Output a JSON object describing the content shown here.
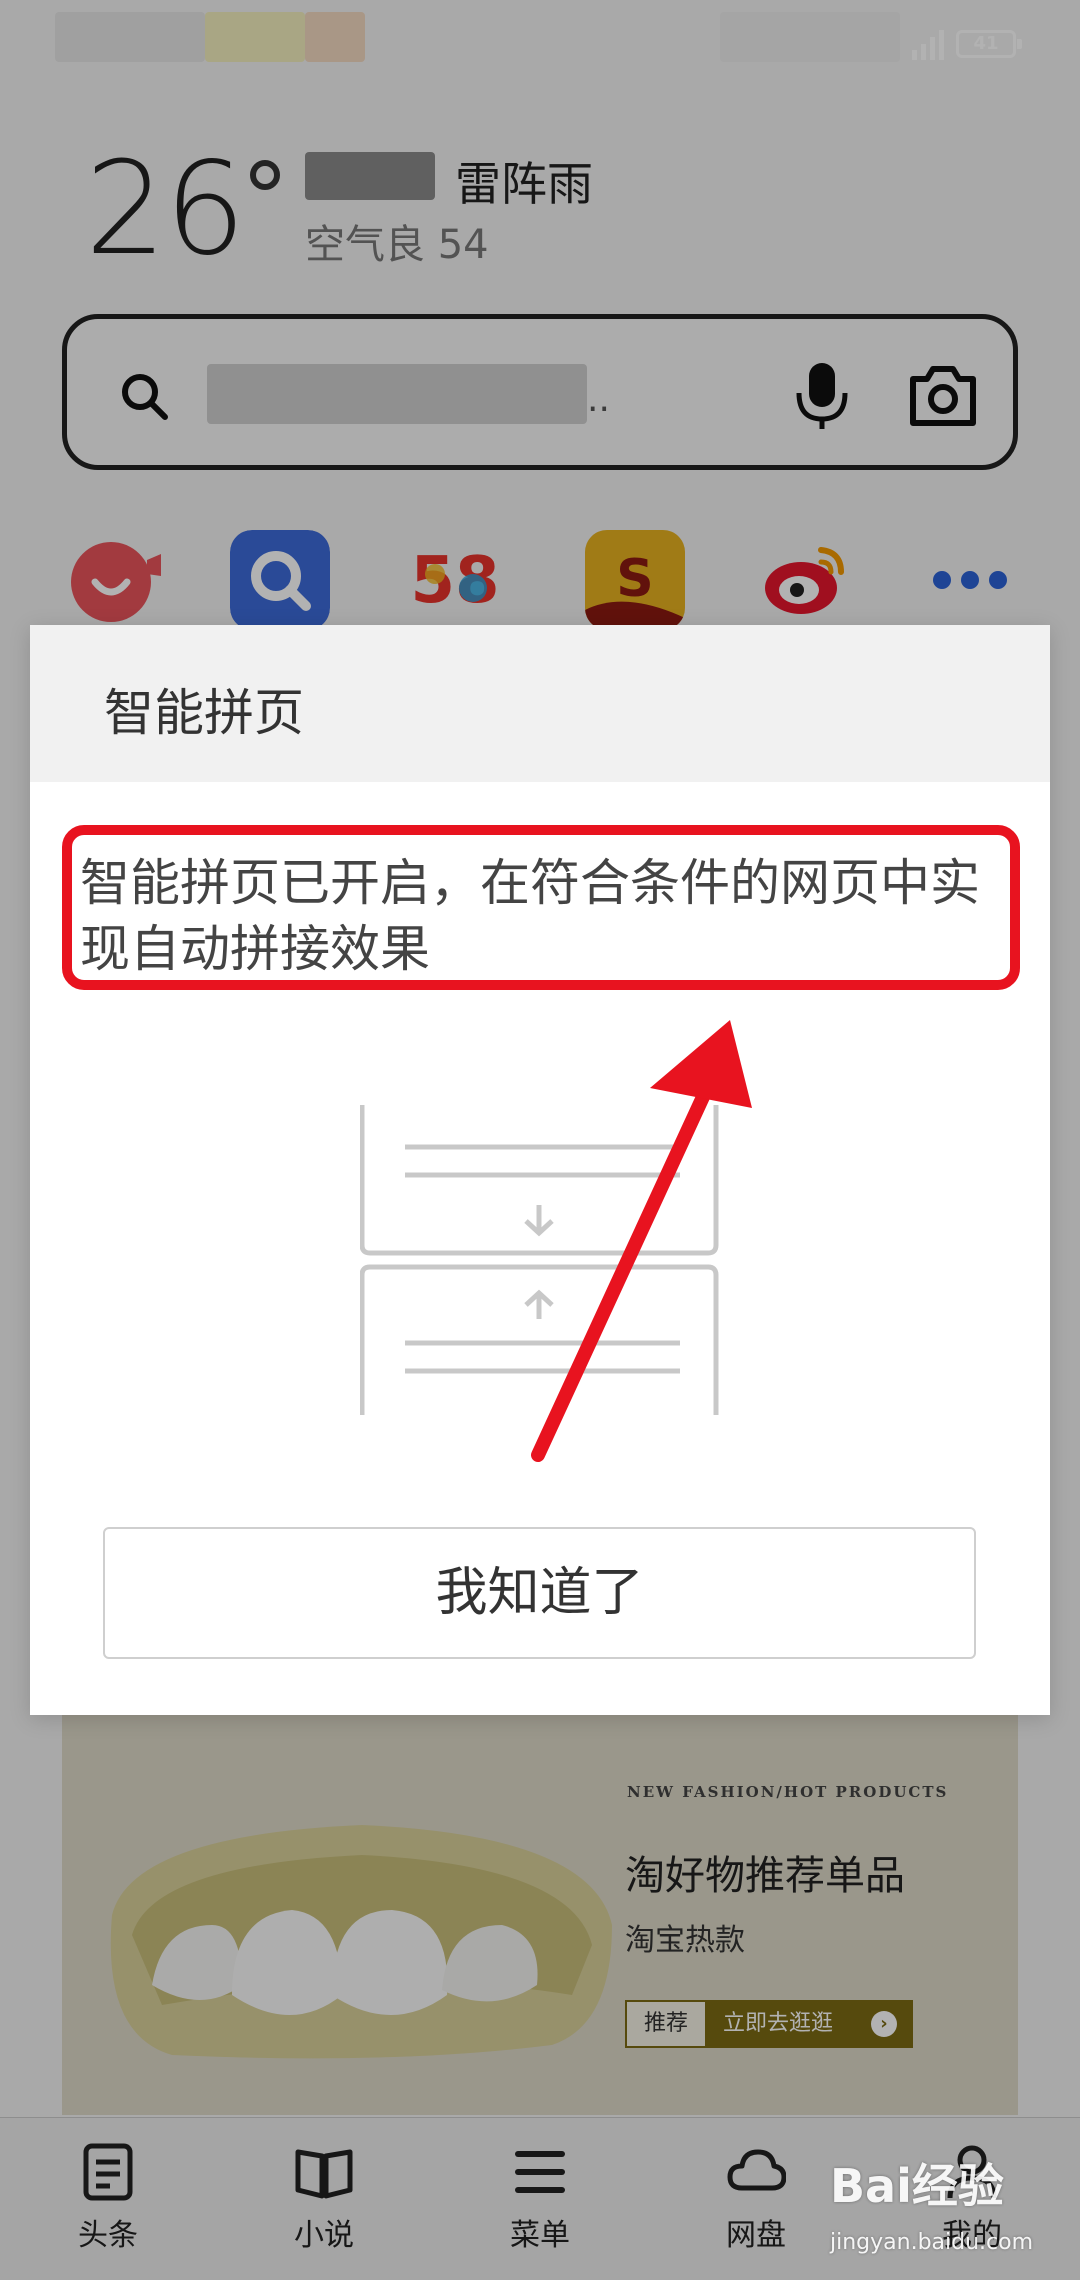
{
  "weather": {
    "temperature": "26",
    "condition": "雷阵雨",
    "air_quality": "空气良 54"
  },
  "search": {
    "dots": ".."
  },
  "shortcuts": [
    {
      "name": "shortcut-app-1",
      "color": "#e8545b"
    },
    {
      "name": "shortcut-app-2",
      "color": "#3d6bd9"
    },
    {
      "name": "shortcut-58",
      "color": "#ffffff"
    },
    {
      "name": "shortcut-app-4",
      "color": "#e6b020"
    },
    {
      "name": "shortcut-weibo",
      "color": "#ffffff"
    },
    {
      "name": "shortcut-more",
      "color": "#2b62d6"
    }
  ],
  "dialog": {
    "title": "智能拼页",
    "message": "智能拼页已开启，在符合条件的网页中实现自动拼接效果",
    "button_label": "我知道了"
  },
  "ad": {
    "eyebrow": "NEW FASHION/HOT PRODUCTS",
    "title": "淘好物推荐单品",
    "subtitle": "淘宝热款",
    "cta_left": "推荐",
    "cta_right": "立即去逛逛"
  },
  "bottom_nav": {
    "items": [
      {
        "label": "头条"
      },
      {
        "label": "小说"
      },
      {
        "label": "菜单"
      },
      {
        "label": "网盘"
      },
      {
        "label": "我的"
      }
    ]
  },
  "status": {
    "battery": "41"
  },
  "watermark": {
    "brand": "Bai经验",
    "url": "jingyan.baidu.com"
  },
  "colors": {
    "highlight": "#e8131f",
    "ad_accent": "#7b6a13"
  }
}
